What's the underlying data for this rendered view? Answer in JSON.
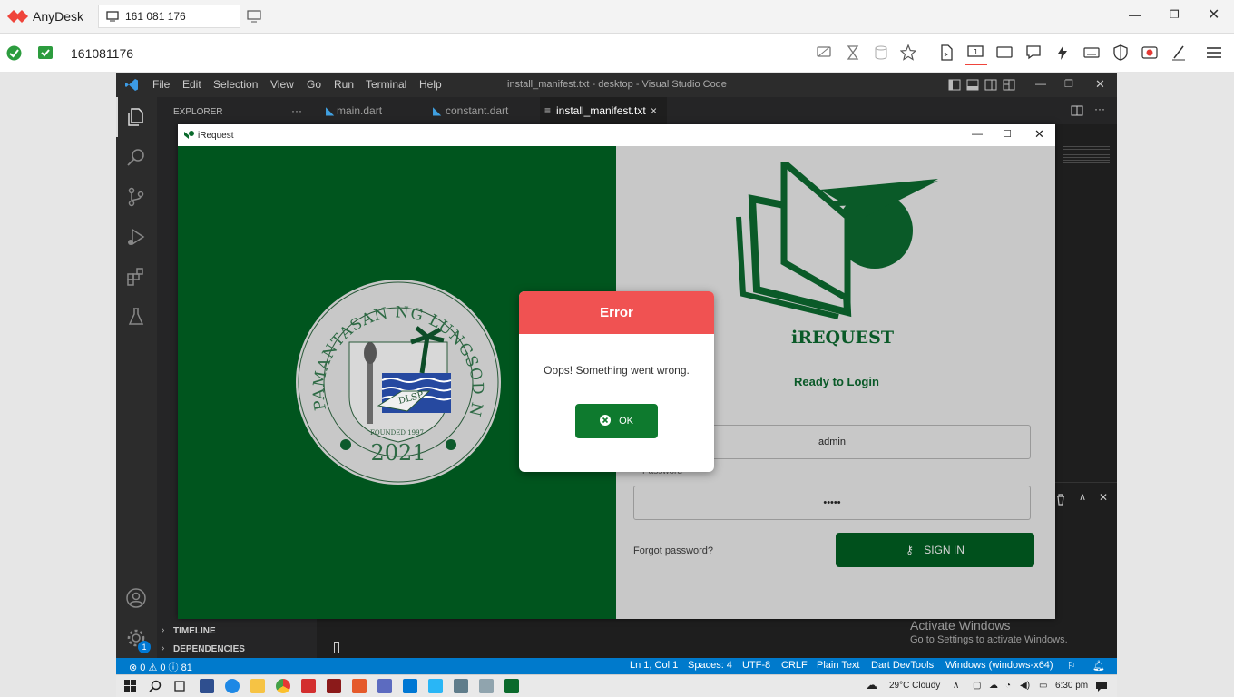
{
  "anydesk": {
    "app_name": "AnyDesk",
    "tab_address": "161 081 176",
    "address_value": "161081176",
    "colors": {
      "brand": "#ef443b",
      "ok": "#2c9c3e"
    }
  },
  "vscode": {
    "title": "install_manifest.txt - desktop - Visual Studio Code",
    "menu": [
      "File",
      "Edit",
      "Selection",
      "View",
      "Go",
      "Run",
      "Terminal",
      "Help"
    ],
    "explorer_label": "EXPLORER",
    "explorer_more": "···",
    "tabs": [
      {
        "label": "main.dart"
      },
      {
        "label": "constant.dart"
      },
      {
        "label": "install_manifest.txt",
        "close": "×"
      }
    ],
    "sidebar_sections": [
      {
        "label": "TIMELINE"
      },
      {
        "label": "DEPENDENCIES"
      }
    ],
    "status": {
      "problems": "⊗ 0 ⚠ 0 ⓘ 81",
      "position": "Ln 1, Col 1",
      "spaces": "Spaces: 4",
      "encoding": "UTF-8",
      "eol": "CRLF",
      "language": "Plain Text",
      "devtools": "Dart DevTools",
      "device": "Windows (windows-x64)"
    },
    "settings_badge": "1",
    "activate_title": "Activate Windows",
    "activate_sub": "Go to Settings to activate Windows."
  },
  "irequest": {
    "window_title": "iRequest",
    "app_title": "iREQUEST",
    "subtitle": "Ready to Login",
    "username_value": "admin",
    "password_label": "Password",
    "password_value": "•••••",
    "forgot_password": "Forgot password?",
    "sign_in": "SIGN IN",
    "seal": {
      "ring_text": "PAMANTASAN NG LUNGSOD NG SAN PABLO",
      "year": "2021",
      "founded": "FOUNDED 1997",
      "book_text": "DLSP"
    },
    "colors": {
      "green": "#00551e",
      "right_bg": "#c8c8c8"
    }
  },
  "dialog": {
    "title": "Error",
    "message": "Oops! Something went wrong.",
    "ok_label": "OK",
    "colors": {
      "header": "#f05252",
      "button": "#0e7a2e"
    }
  },
  "taskbar": {
    "weather": "29°C  Cloudy",
    "time": "6:30 pm"
  }
}
